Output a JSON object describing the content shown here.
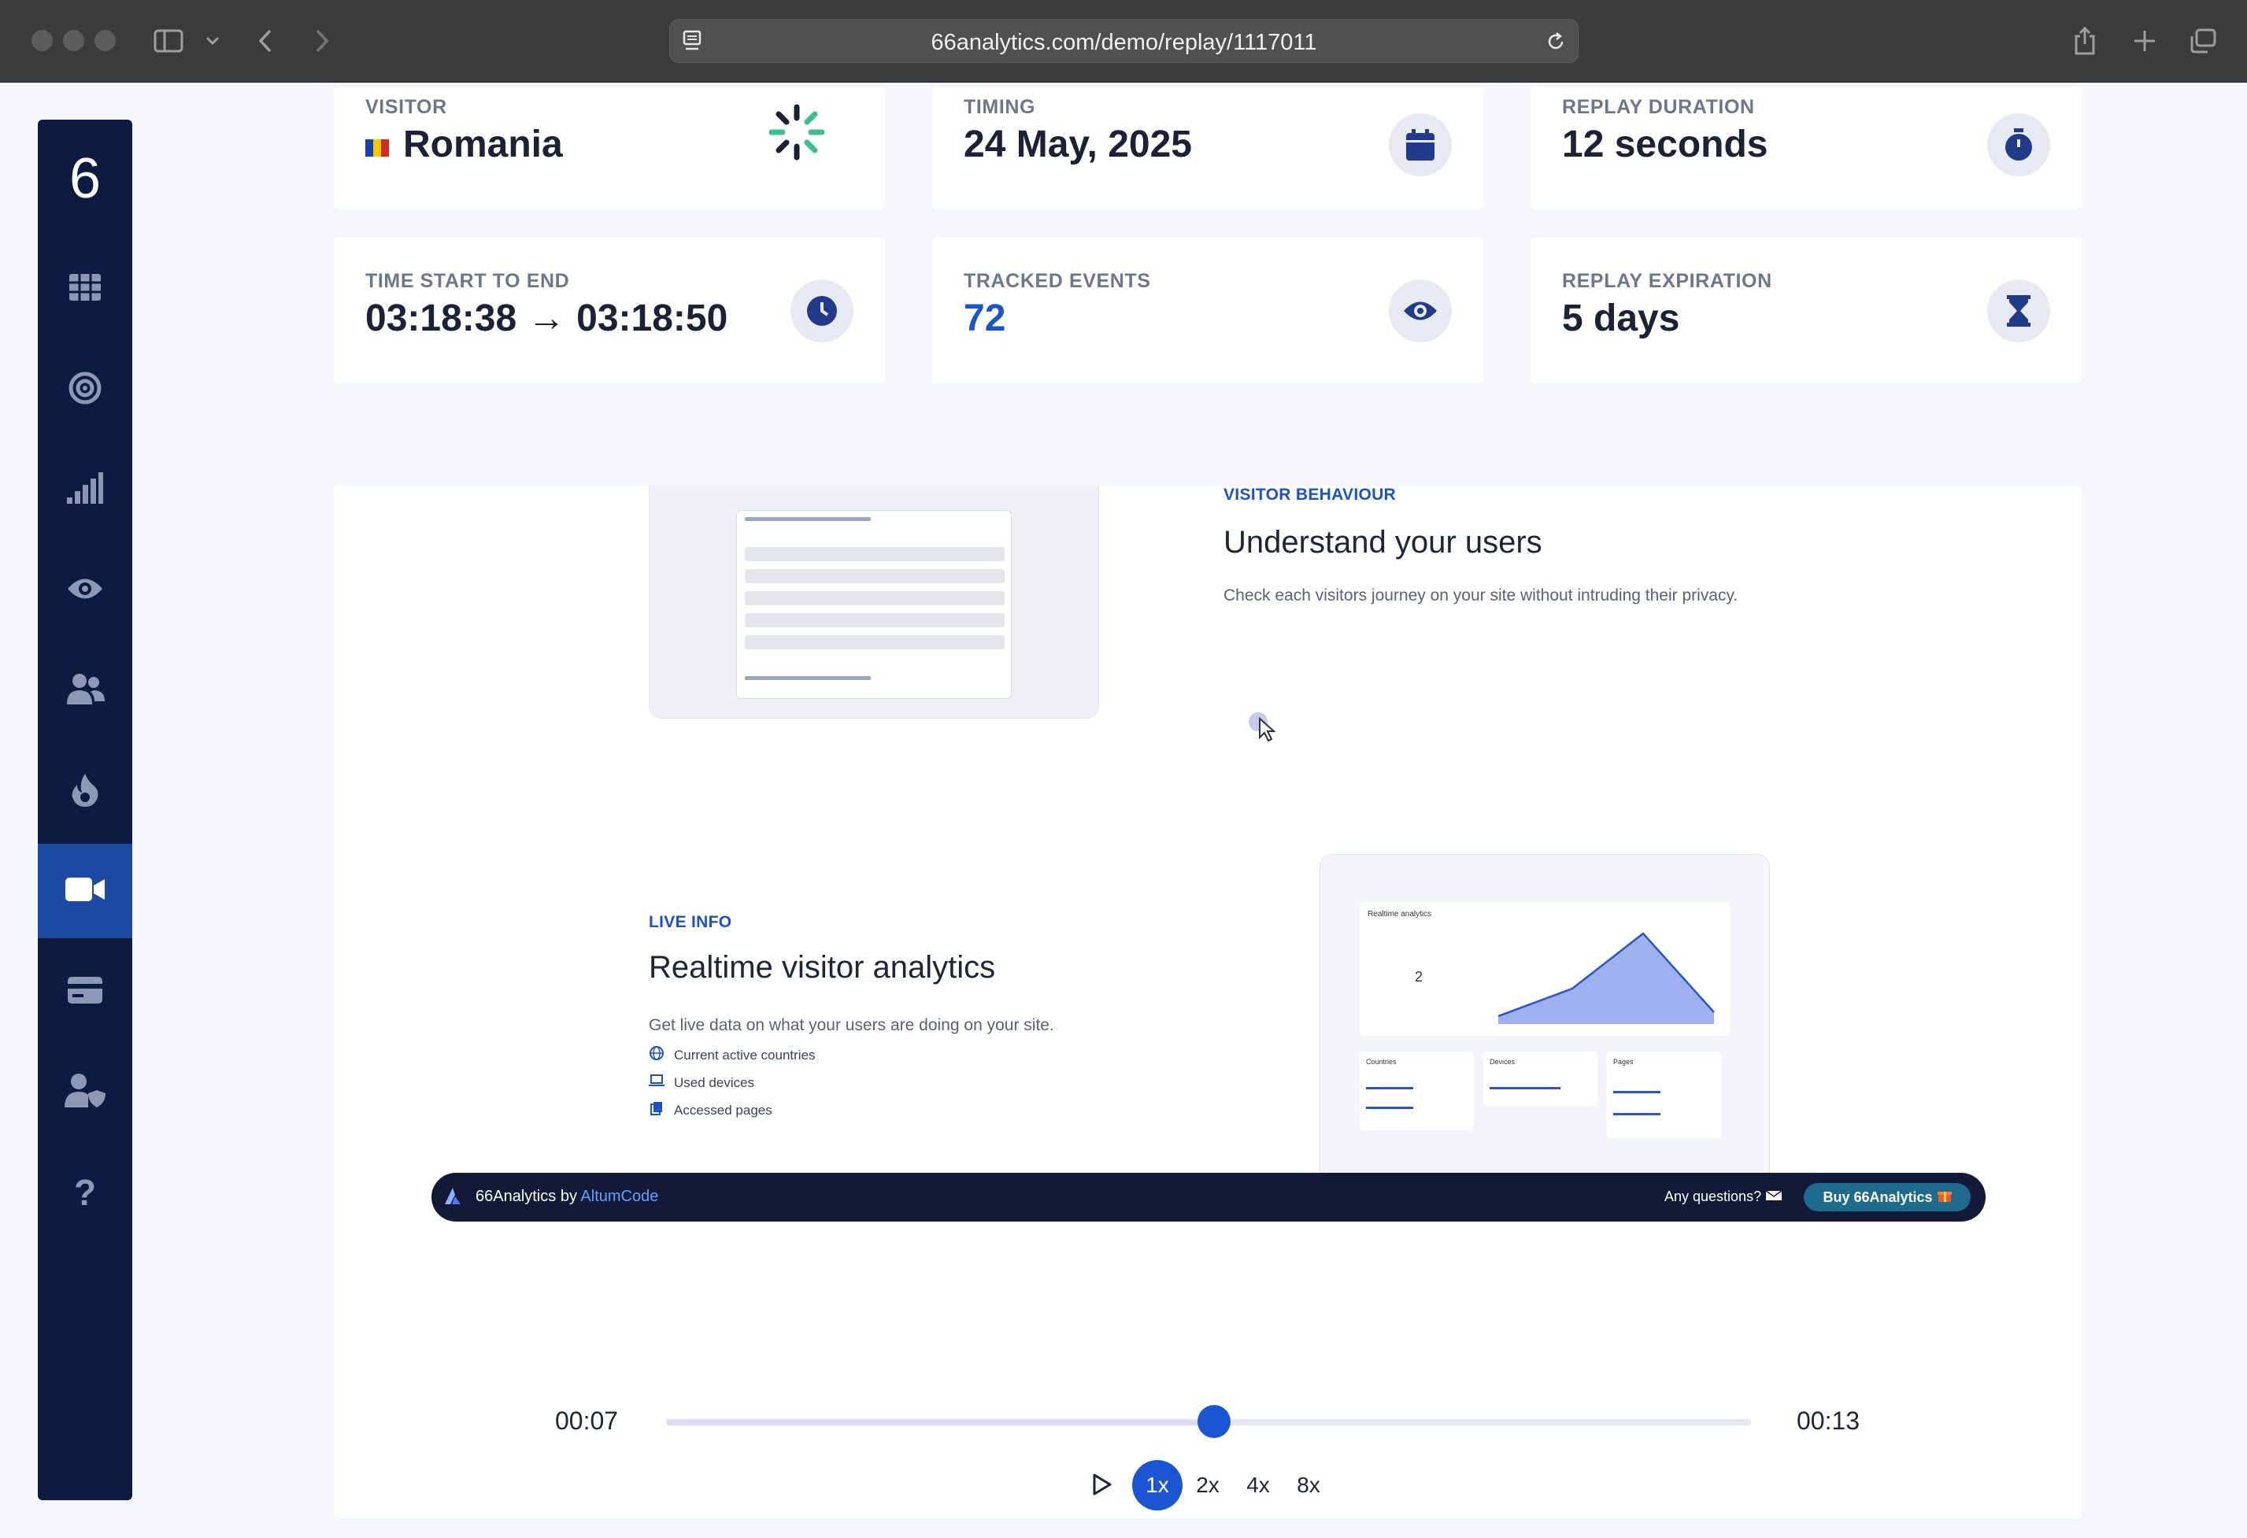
{
  "browser": {
    "url": "66analytics.com/demo/replay/1117011"
  },
  "sidebar": {
    "logo": "6",
    "items": [
      {
        "icon": "grid-icon",
        "active": false
      },
      {
        "icon": "target-icon",
        "active": false
      },
      {
        "icon": "signal-bars-icon",
        "active": false
      },
      {
        "icon": "eye-icon",
        "active": false
      },
      {
        "icon": "users-icon",
        "active": false
      },
      {
        "icon": "fire-icon",
        "active": false
      },
      {
        "icon": "video-camera-icon",
        "active": true
      },
      {
        "icon": "card-icon",
        "active": false
      },
      {
        "icon": "user-shield-icon",
        "active": false
      },
      {
        "icon": "question-icon",
        "active": false
      }
    ]
  },
  "stats": {
    "visitor": {
      "label": "VISITOR",
      "value": "Romania",
      "icon": "loader-icon"
    },
    "timing": {
      "label": "TIMING",
      "value": "24 May, 2025",
      "icon": "calendar-icon"
    },
    "replay_duration": {
      "label": "REPLAY DURATION",
      "value": "12 seconds",
      "icon": "stopwatch-icon"
    },
    "time_start_end": {
      "label": "TIME START TO END",
      "start": "03:18:38",
      "arrow": "→",
      "end": "03:18:50",
      "icon": "clock-icon"
    },
    "tracked_events": {
      "label": "TRACKED EVENTS",
      "value": "72",
      "icon": "eye-icon"
    },
    "replay_expiration": {
      "label": "REPLAY EXPIRATION",
      "value": "5 days",
      "icon": "hourglass-icon"
    }
  },
  "replay": {
    "behaviour": {
      "tag": "VISITOR BEHAVIOUR",
      "title": "Understand your users",
      "description": "Check each visitors journey on your site without intruding their privacy."
    },
    "live": {
      "tag": "LIVE INFO",
      "title": "Realtime visitor analytics",
      "description": "Get live data on what your users are doing on your site.",
      "features": [
        "Current active countries",
        "Used devices",
        "Accessed pages"
      ]
    },
    "mock_realtime": {
      "title": "Realtime analytics",
      "count": "2",
      "tabs": [
        "Countries",
        "Devices",
        "Pages"
      ]
    },
    "banner": {
      "brand_prefix": "66Analytics by",
      "brand_name": "AltumCode",
      "questions": "Any questions?",
      "buy": "Buy 66Analytics"
    }
  },
  "player": {
    "current_time": "00:07",
    "total_time": "00:13",
    "progress": 0.505,
    "speeds": [
      "1x",
      "2x",
      "4x",
      "8x"
    ],
    "active_speed": "1x"
  },
  "colors": {
    "sidebar": "#0c1b3f",
    "accent": "#1c55d1",
    "active_sidebar": "#1d4aa3",
    "background": "#f4f6fc"
  }
}
